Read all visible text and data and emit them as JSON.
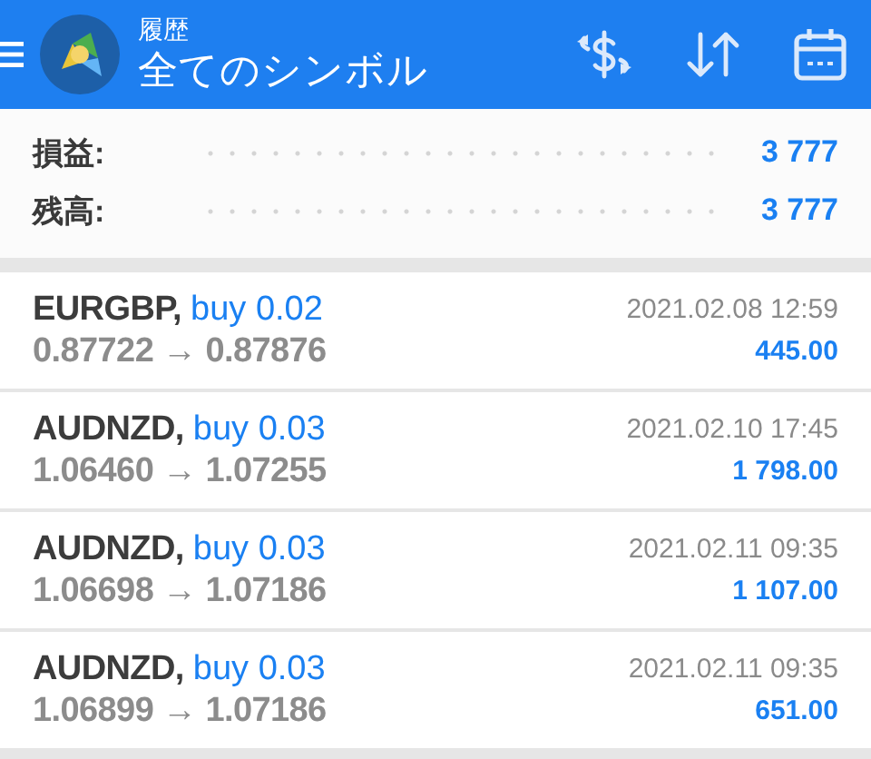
{
  "header": {
    "subtitle": "履歴",
    "title": "全てのシンボル"
  },
  "summary": [
    {
      "label": "損益:",
      "value": "3 777"
    },
    {
      "label": "残高:",
      "value": "3 777"
    }
  ],
  "deals": [
    {
      "symbol": "EURGBP,",
      "action": "buy 0.02",
      "prices": "0.87722 → 0.87876",
      "time": "2021.02.08 12:59",
      "profit": "445.00"
    },
    {
      "symbol": "AUDNZD,",
      "action": "buy 0.03",
      "prices": "1.06460 → 1.07255",
      "time": "2021.02.10 17:45",
      "profit": "1 798.00"
    },
    {
      "symbol": "AUDNZD,",
      "action": "buy 0.03",
      "prices": "1.06698 → 1.07186",
      "time": "2021.02.11 09:35",
      "profit": "1 107.00"
    },
    {
      "symbol": "AUDNZD,",
      "action": "buy 0.03",
      "prices": "1.06899 → 1.07186",
      "time": "2021.02.11 09:35",
      "profit": "651.00"
    }
  ]
}
